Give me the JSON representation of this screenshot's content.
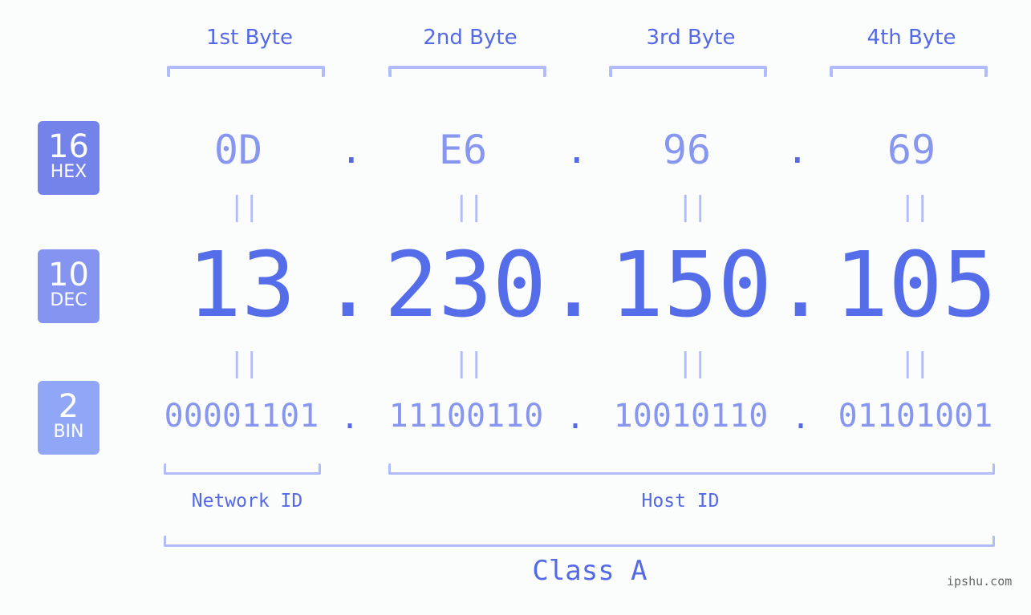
{
  "bytes": [
    {
      "label": "1st Byte",
      "hex": "0D",
      "dec": "13",
      "bin": "00001101"
    },
    {
      "label": "2nd Byte",
      "hex": "E6",
      "dec": "230",
      "bin": "11100110"
    },
    {
      "label": "3rd Byte",
      "hex": "96",
      "dec": "150",
      "bin": "10010110"
    },
    {
      "label": "4th Byte",
      "hex": "69",
      "dec": "105",
      "bin": "01101001"
    }
  ],
  "separator": ".",
  "equals": "||",
  "badges": {
    "hex": {
      "num": "16",
      "label": "HEX",
      "color": "#7383ea"
    },
    "dec": {
      "num": "10",
      "label": "DEC",
      "color": "#8494f0"
    },
    "bin": {
      "num": "2",
      "label": "BIN",
      "color": "#90a7f8"
    }
  },
  "network_id_label": "Network ID",
  "host_id_label": "Host ID",
  "class_label": "Class A",
  "watermark": "ipshu.com",
  "colors": {
    "accent": "#5469e6",
    "light_value": "#8796ef",
    "bracket": "#b2bcf8",
    "background": "#fbfdfc"
  }
}
